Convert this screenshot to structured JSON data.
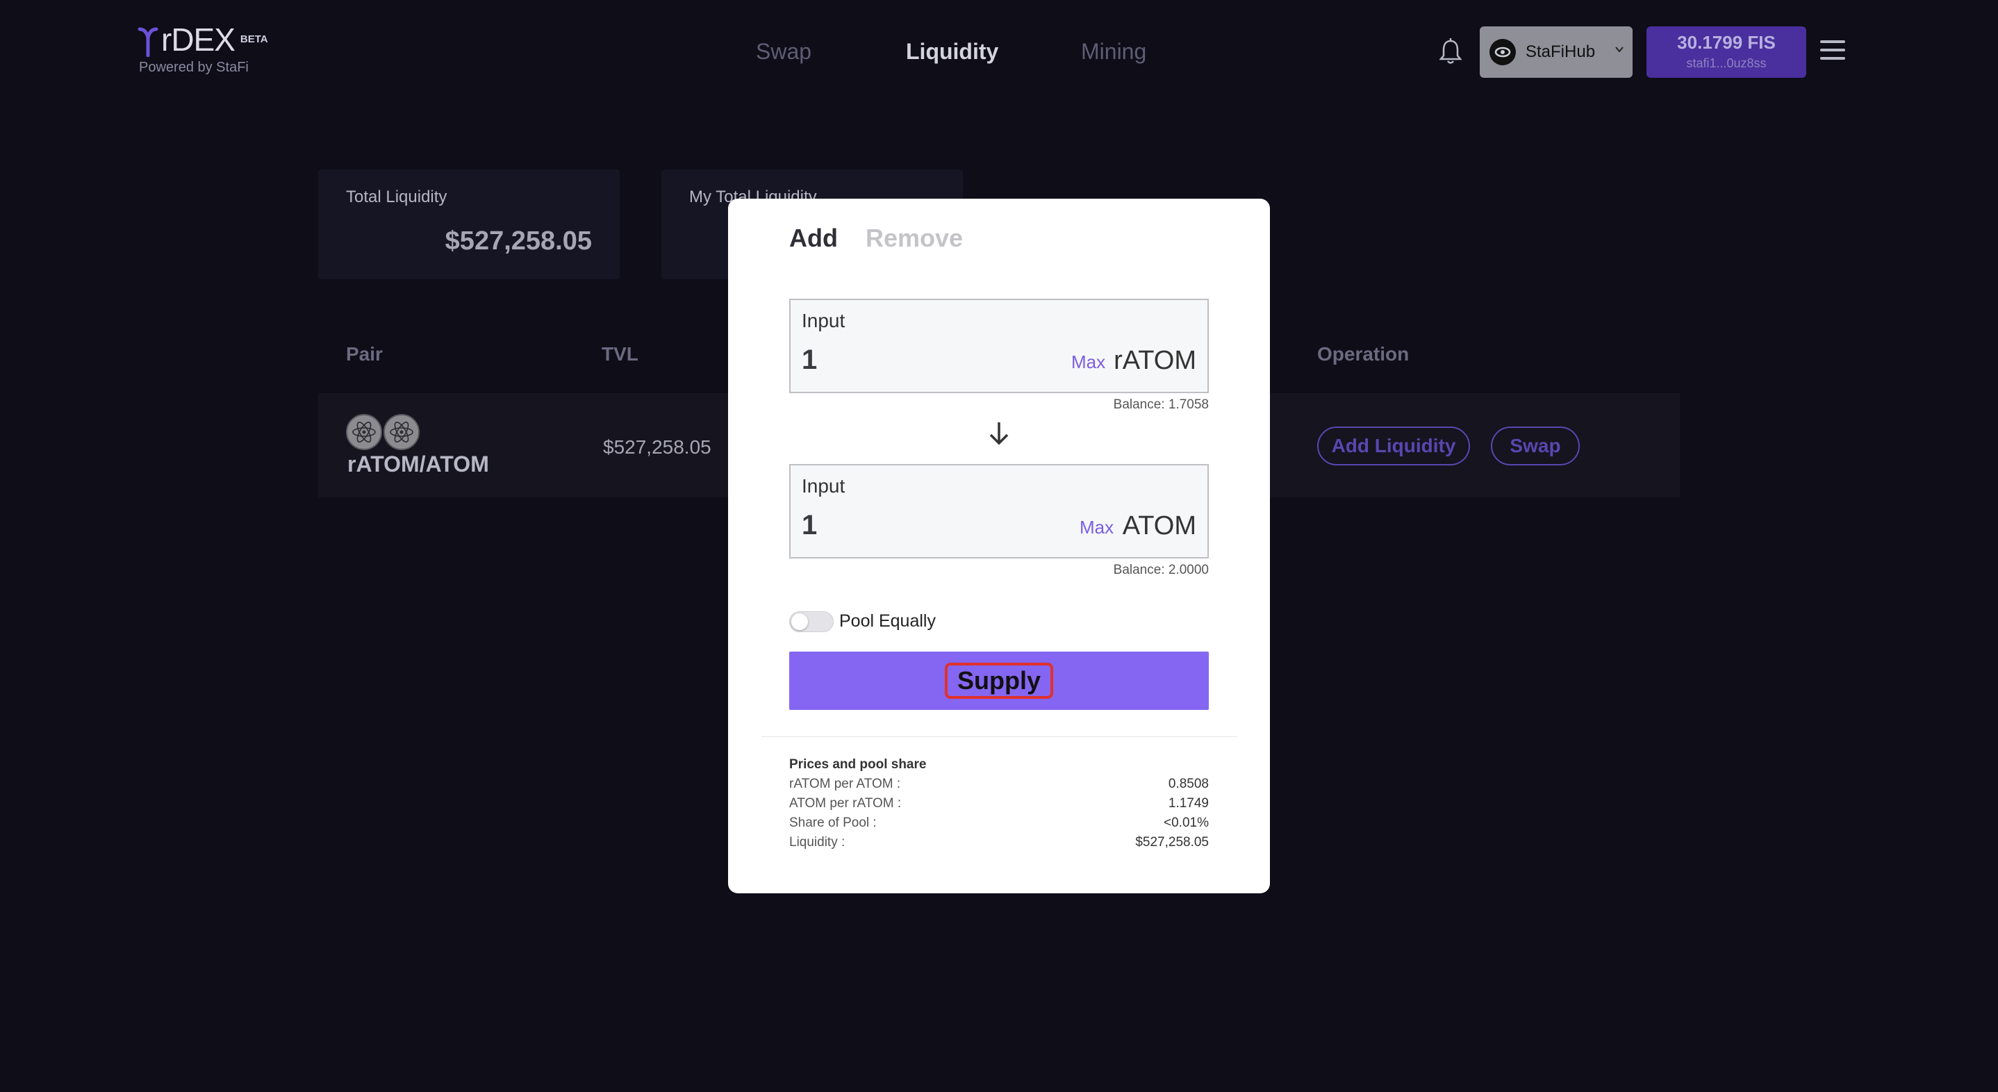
{
  "header": {
    "logo_text": "rDEX",
    "logo_badge": "BETA",
    "logo_sub": "Powered by StaFi",
    "nav": {
      "swap": "Swap",
      "liquidity": "Liquidity",
      "mining": "Mining"
    },
    "network": {
      "name": "StaFiHub"
    },
    "account": {
      "balance": "30.1799 FIS",
      "address": "stafi1...0uz8ss"
    }
  },
  "summary": {
    "total_label": "Total Liquidity",
    "total_value": "$527,258.05",
    "my_label": "My Total Liquidity"
  },
  "table": {
    "headers": {
      "pair": "Pair",
      "tvl": "TVL",
      "operation": "Operation"
    },
    "rows": [
      {
        "pair": "rATOM/ATOM",
        "tvl": "$527,258.05",
        "add": "Add Liquidity",
        "swap": "Swap"
      }
    ]
  },
  "modal": {
    "tabs": {
      "add": "Add",
      "remove": "Remove"
    },
    "input1": {
      "label": "Input",
      "value": "1",
      "max": "Max",
      "token": "rATOM",
      "balance": "Balance: 1.7058"
    },
    "input2": {
      "label": "Input",
      "value": "1",
      "max": "Max",
      "token": "ATOM",
      "balance": "Balance: 2.0000"
    },
    "pool_equally": "Pool Equally",
    "supply": "Supply",
    "info": {
      "title": "Prices and pool share",
      "rows": [
        {
          "label": "rATOM per ATOM :",
          "value": "0.8508"
        },
        {
          "label": "ATOM per rATOM :",
          "value": "1.1749"
        },
        {
          "label": "Share of Pool :",
          "value": "<0.01%"
        },
        {
          "label": "Liquidity :",
          "value": "$527,258.05"
        }
      ]
    }
  },
  "colors": {
    "accent": "#8466f2",
    "background": "#0e0d18",
    "highlight": "#e0312b"
  }
}
